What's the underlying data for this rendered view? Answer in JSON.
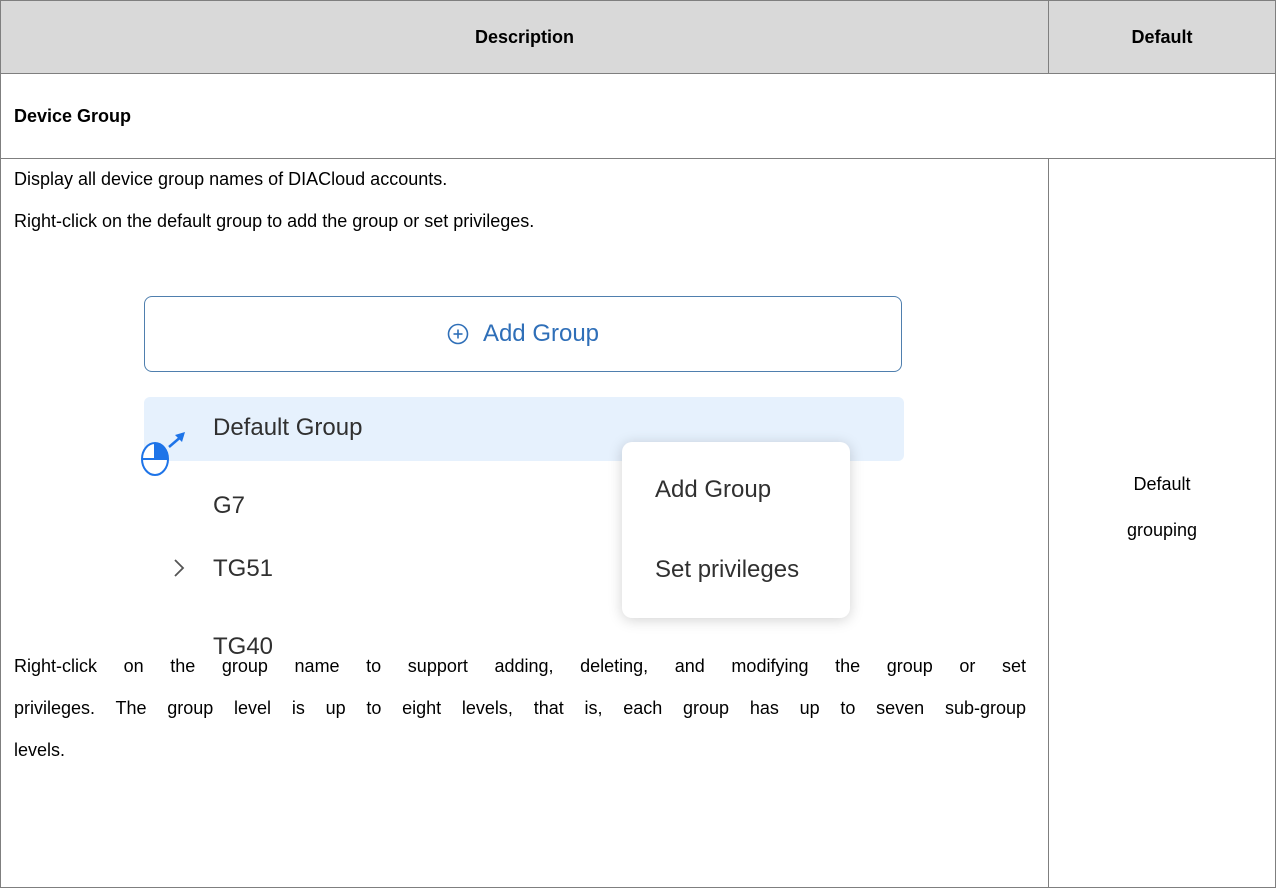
{
  "table": {
    "header": {
      "description": "Description",
      "default": "Default"
    },
    "section_title": "Device Group",
    "row": {
      "line1": "Display all device group names of DIACloud accounts.",
      "line2": "Right-click on the default group to add the group or set privileges.",
      "para_lines": [
        "Right-click on the group name to support adding, deleting, and modifying the group or set",
        "privileges. The group level is up to eight levels, that is, each group has up to seven sub-group",
        "levels."
      ],
      "default_lines": [
        "Default",
        "grouping"
      ]
    }
  },
  "illustration": {
    "add_group_button": "Add Group",
    "tree": {
      "default_group": "Default Group",
      "g7": "G7",
      "tg51": "TG51",
      "tg40": "TG40"
    },
    "context_menu": {
      "add_group": "Add Group",
      "set_privileges": "Set privileges"
    },
    "icons": {
      "add": "plus-circle-icon",
      "cursor": "mouse-right-click-icon",
      "expand": "chevron-right-icon"
    },
    "colors": {
      "accent": "#2f6fb8",
      "selected_row": "#e6f1fd",
      "cursor": "#1e74e8"
    }
  }
}
